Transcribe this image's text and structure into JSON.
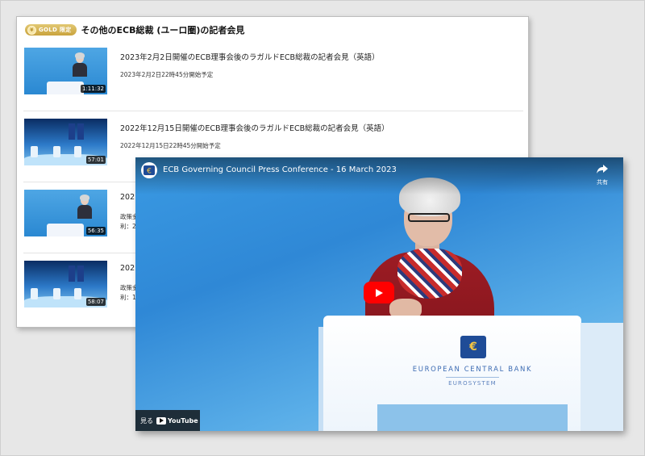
{
  "list": {
    "badge": "GOLD 限定",
    "coin_icon": "coin-icon",
    "title": "その他のECB総裁 (ユーロ圏)の記者会見",
    "items": [
      {
        "title": "2023年2月2日開催のECB理事会後のラガルドECB総裁の記者会見（英語）",
        "subtitle": "2023年2月2日22時45分開始予定",
        "subtitle2": "",
        "duration": "1:11:32",
        "thumb": "speaker"
      },
      {
        "title": "2022年12月15日開催のECB理事会後のラガルドECB総裁の記者会見（英語）",
        "subtitle": "2022年12月15日22時45分開始予定",
        "subtitle2": "",
        "duration": "57:01",
        "thumb": "stage"
      },
      {
        "title": "202",
        "subtitle": "政策金",
        "subtitle2": "利：2",
        "duration": "56:35",
        "thumb": "speaker"
      },
      {
        "title": "202",
        "subtitle": "政策金",
        "subtitle2": "利：1",
        "duration": "58:07",
        "thumb": "stage"
      }
    ]
  },
  "player": {
    "title": "ECB Governing Council Press Conference - 16 March 2023",
    "share_label": "共有",
    "watch_label": "見る",
    "youtube_label": "YouTube",
    "podium_name": "EUROPEAN CENTRAL BANK",
    "podium_sub": "EUROSYSTEM",
    "podium_symbol": "€",
    "play_color": "#ff0000"
  }
}
